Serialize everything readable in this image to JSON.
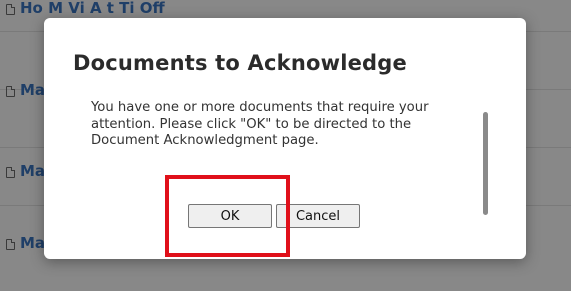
{
  "background_list": {
    "rows": [
      {
        "label": "Ho  M          Vi     A        t  Ti     Off"
      },
      {
        "label": "Ma"
      },
      {
        "label": "Ma"
      },
      {
        "label": "Ma"
      }
    ]
  },
  "modal": {
    "title": "Documents to Acknowledge",
    "body": "You have one or more documents that require your attention. Please click \"OK\" to be directed to the Document Acknowledgment page.",
    "ok_label": "OK",
    "cancel_label": "Cancel"
  },
  "colors": {
    "overlay": "#888888",
    "link": "#1f3f68",
    "highlight": "#e0101a"
  },
  "icons": [
    "document-icon"
  ]
}
